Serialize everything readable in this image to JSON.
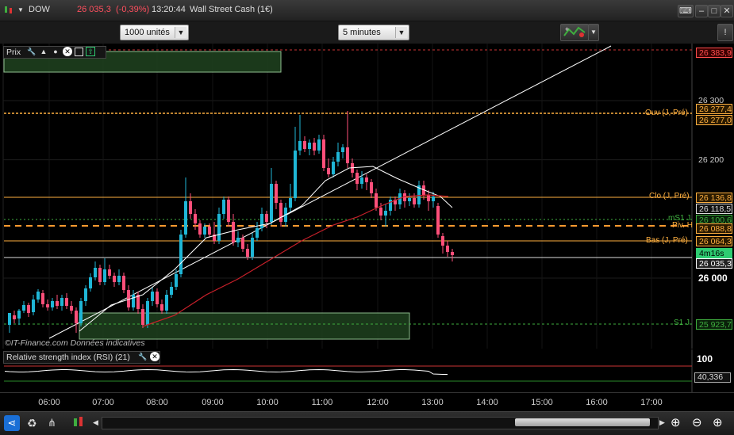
{
  "title_bar": {
    "symbol": "DOW",
    "price": "26 035,3",
    "change": "(-0,39%)",
    "time": "13:20:44",
    "instrument": "Wall Street Cash (1€)"
  },
  "toolbar": {
    "quantity": "1000 unités",
    "interval": "5 minutes"
  },
  "price_panel": {
    "label": "Prix",
    "price_axis": {
      "labels": [
        {
          "text": "26 383,9",
          "color": "#ff4d4d",
          "box": "#3a0000",
          "kind": "box"
        },
        {
          "text": "26 300",
          "color": "#ccc",
          "box": "",
          "kind": "tick"
        },
        {
          "text": "26 277,4",
          "color": "#ffb040",
          "box": "#2a1a00",
          "kind": "box"
        },
        {
          "text": "26 277,0",
          "color": "#ffb040",
          "box": "#2a1a00",
          "kind": "box"
        },
        {
          "text": "26 200",
          "color": "#ccc",
          "box": "",
          "kind": "tick"
        },
        {
          "text": "26 136,8",
          "color": "#ffb040",
          "box": "#2a1a00",
          "kind": "box"
        },
        {
          "text": "26 118,5",
          "color": "#ddd",
          "box": "#111",
          "kind": "box"
        },
        {
          "text": "26 100,6",
          "color": "#3fae3f",
          "box": "#0a200a",
          "kind": "box"
        },
        {
          "text": "26 088,8",
          "color": "#ffb040",
          "box": "#2a1a00",
          "kind": "box"
        },
        {
          "text": "26 064,3",
          "color": "#ffb040",
          "box": "#2a1a00",
          "kind": "box"
        },
        {
          "text": "4m16s",
          "color": "#000",
          "box": "#2ecc71",
          "kind": "box"
        },
        {
          "text": "26 035,3",
          "color": "#fff",
          "box": "#222",
          "kind": "box"
        },
        {
          "text": "26 000",
          "color": "#fff",
          "box": "",
          "kind": "tick"
        },
        {
          "text": "25 923,7",
          "color": "#3fae3f",
          "box": "#0a200a",
          "kind": "box"
        }
      ]
    },
    "levels": [
      {
        "text": "Ouv (J, Pré)",
        "color": "#ffb040"
      },
      {
        "text": "Clo (J, Pré)",
        "color": "#ffb040"
      },
      {
        "text": "mS1 J",
        "color": "#3fae3f"
      },
      {
        "text": "Piv. H",
        "color": "#ffb040"
      },
      {
        "text": "Bas (J, Pré)",
        "color": "#ffb040"
      },
      {
        "text": "S1 J",
        "color": "#3fae3f"
      }
    ],
    "watermark": "©IT-Finance.com  Données indicatives"
  },
  "rsi_panel": {
    "label": "Relative strength index (RSI) (21)",
    "level_top": "100",
    "value": "40,336"
  },
  "x_axis": {
    "ticks": [
      "06:00",
      "07:00",
      "08:00",
      "09:00",
      "10:00",
      "11:00",
      "12:00",
      "13:00",
      "14:00",
      "15:00",
      "16:00",
      "17:00"
    ]
  },
  "colors": {
    "up_candle": "#1fb6d6",
    "down_candle": "#ff4f7a",
    "ma_white": "#ffffff",
    "ma_red": "#c8202a",
    "zone_green": "#1d3d1d"
  }
}
